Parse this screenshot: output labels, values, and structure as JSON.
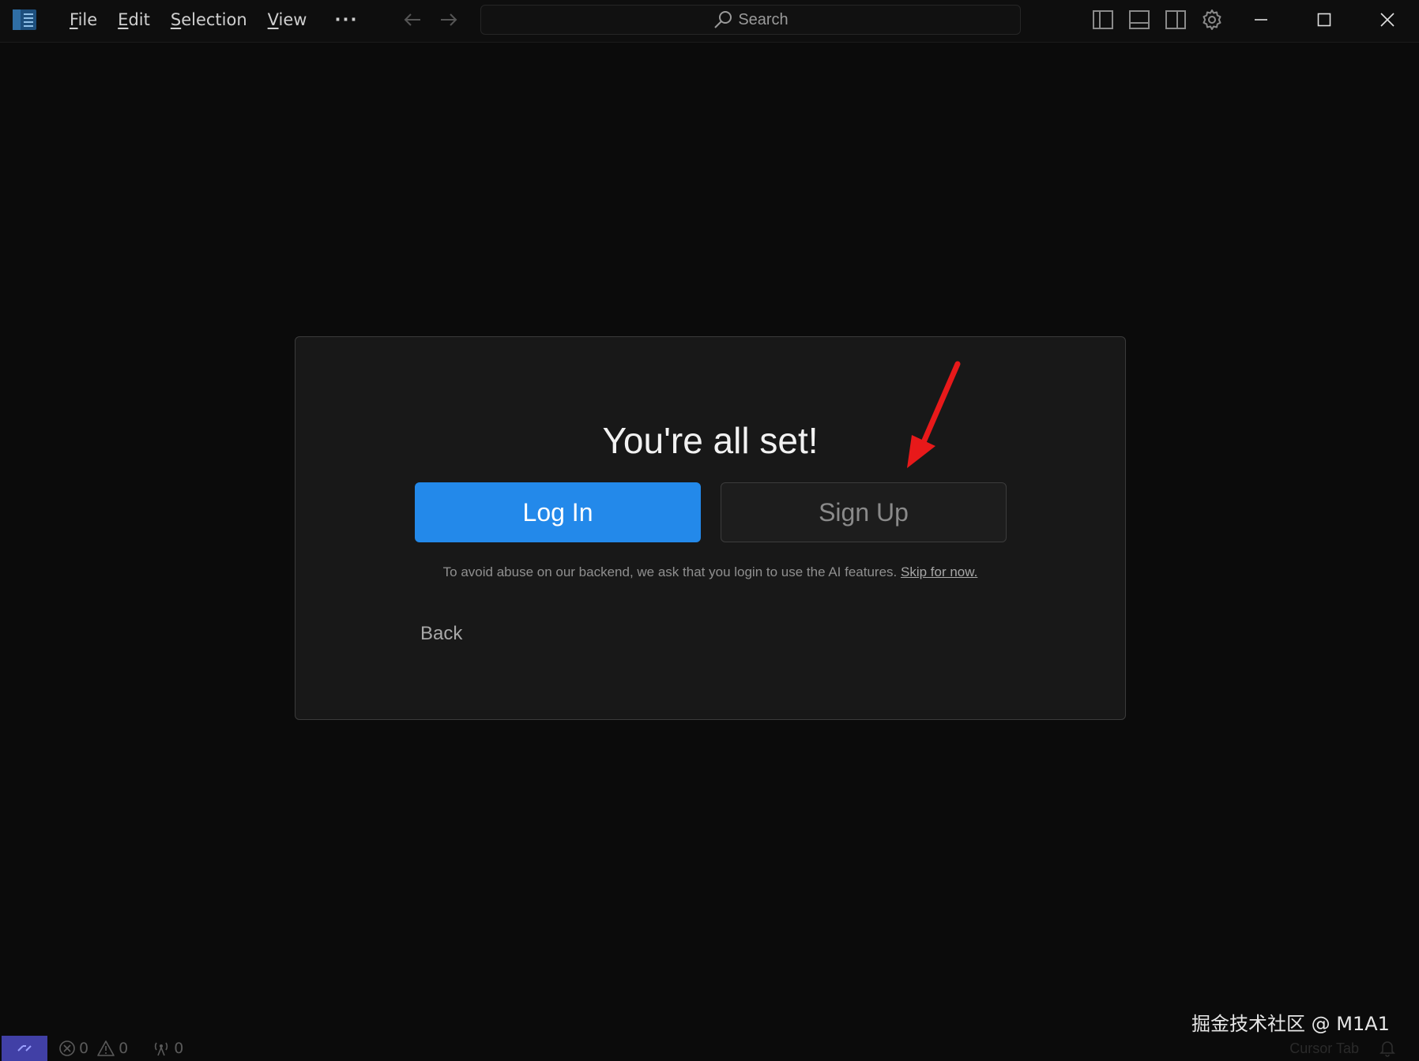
{
  "menu": {
    "items": [
      {
        "mnemonic": "F",
        "rest": "ile"
      },
      {
        "mnemonic": "E",
        "rest": "dit"
      },
      {
        "mnemonic": "S",
        "rest": "election"
      },
      {
        "mnemonic": "V",
        "rest": "iew"
      }
    ],
    "more": "···"
  },
  "search": {
    "placeholder": "Search"
  },
  "dialog": {
    "title": "You're all set!",
    "login_label": "Log In",
    "signup_label": "Sign Up",
    "notice_text": "To avoid abuse on our backend, we ask that you login to use the AI features. ",
    "skip_label": "Skip for now.",
    "back_label": "Back"
  },
  "status": {
    "errors": "0",
    "warnings": "0",
    "ports": "0",
    "cursor_tab": "Cursor Tab"
  },
  "watermark": "掘金技术社区 @ M1A1",
  "colors": {
    "accent": "#2389ea",
    "remote": "#4140a6",
    "annotation": "#e8191a"
  }
}
